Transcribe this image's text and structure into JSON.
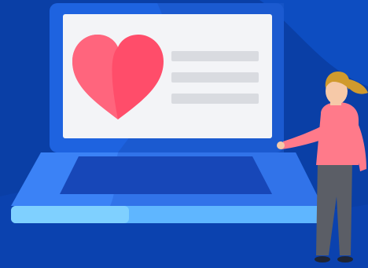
{
  "scene": {
    "subject": "laptop-with-heart-and-woman",
    "colors": {
      "background": "#0a3fa6",
      "background_wave": "#0d4fc4",
      "laptop_shell": "#1e63e0",
      "laptop_screen": "#f3f4f7",
      "laptop_base_top": "#3b82f6",
      "laptop_base_edge": "#7fd0ff",
      "trackpad": "#1747b8",
      "heart": "#ff4d6a",
      "heart_highlight": "#ff6f86",
      "text_lines": "#d9dbe0",
      "woman_shirt": "#ff7a8a",
      "woman_pants": "#5b5e66",
      "woman_hair": "#d09a2d",
      "woman_skin": "#f6c9a8"
    },
    "icons": [
      "heart-icon"
    ]
  }
}
